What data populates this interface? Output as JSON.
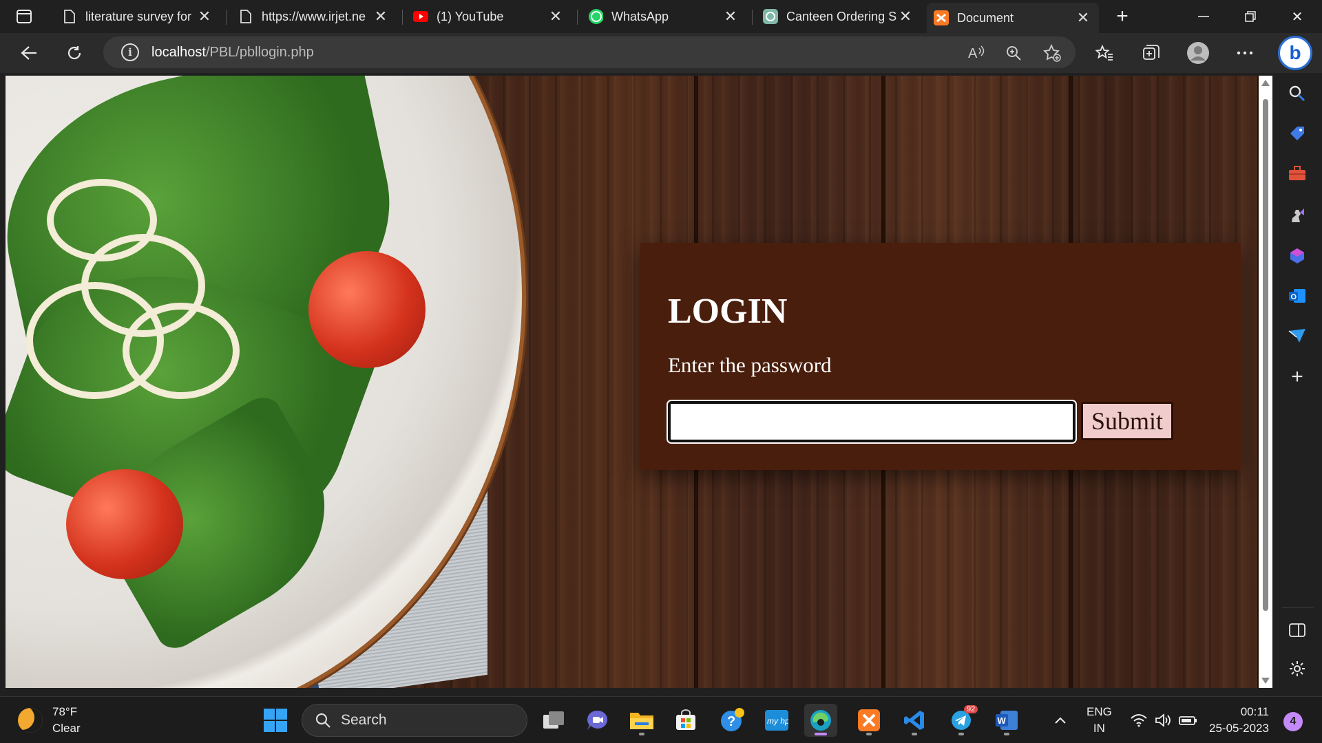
{
  "browser": {
    "tabs": [
      {
        "title": "literature survey for",
        "icon": "document-icon"
      },
      {
        "title": "https://www.irjet.ne",
        "icon": "document-icon"
      },
      {
        "title": "(1) YouTube",
        "icon": "youtube-icon"
      },
      {
        "title": "WhatsApp",
        "icon": "whatsapp-icon"
      },
      {
        "title": "Canteen Ordering S",
        "icon": "chatgpt-icon"
      },
      {
        "title": "Document",
        "icon": "xampp-icon",
        "active": true
      }
    ],
    "address": {
      "host": "localhost",
      "path": "/PBL/pbllogin.php"
    }
  },
  "page": {
    "login_title": "LOGIN",
    "prompt": "Enter the password",
    "password_value": "",
    "submit_label": "Submit"
  },
  "taskbar": {
    "weather_temp": "78°F",
    "weather_desc": "Clear",
    "search_label": "Search",
    "telegram_badge": "92",
    "lang": "ENG",
    "region": "IN",
    "time": "00:11",
    "date": "25-05-2023",
    "notification_count": "4"
  },
  "colors": {
    "login_card": "#4a1e0c",
    "submit_bg": "#f0cccc",
    "accent_bing": "#2b6fd6"
  }
}
